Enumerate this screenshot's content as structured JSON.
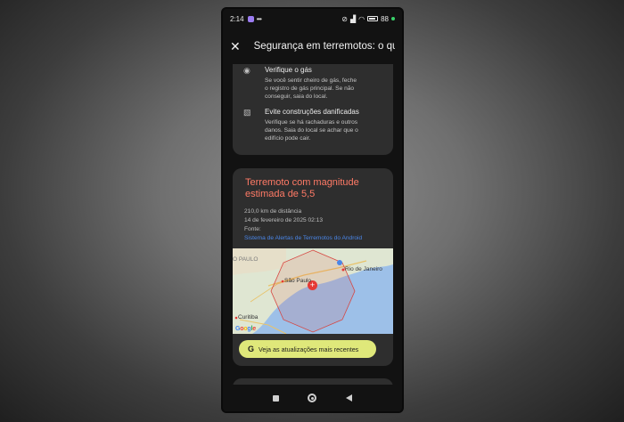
{
  "status_bar": {
    "time": "2:14",
    "more": "•••",
    "battery": "88"
  },
  "app_bar": {
    "close_icon": "close-icon",
    "title": "Segurança em terremotos: o qu..."
  },
  "tips": [
    {
      "icon": "gas-icon",
      "heading": "Verifique o gás",
      "description": [
        "Se você sentir cheiro de gás, feche",
        "o registro de gás principal. Se não",
        "conseguir, saia do local."
      ]
    },
    {
      "icon": "damaged-building-icon",
      "heading": "Evite construções danificadas",
      "description": [
        "Verifique se há rachaduras e outros",
        "danos. Saia do local se achar que o",
        "edifício pode cair."
      ]
    }
  ],
  "quake": {
    "title": "Terremoto com magnitude estimada de 5,5",
    "distance": "210,0 km de distância",
    "date": "14 de fevereiro de 2025 02:13",
    "source_label": "Fonte:",
    "source_link": "Sistema de Alertas de Terremotos do Android"
  },
  "map": {
    "labels": {
      "sao_paulo_state": "O PAULO",
      "sao_paulo": "São Paulo",
      "rio": "Rio de Janeiro",
      "curitiba": "Curitiba"
    },
    "logo": "Google"
  },
  "updates_button": {
    "icon": "G",
    "label": "Veja as atualizações mais recentes"
  },
  "colors": {
    "quake_title": "#ff7a66",
    "link": "#4a86e8",
    "button": "#dfe87a",
    "epicenter": "#e53935"
  }
}
